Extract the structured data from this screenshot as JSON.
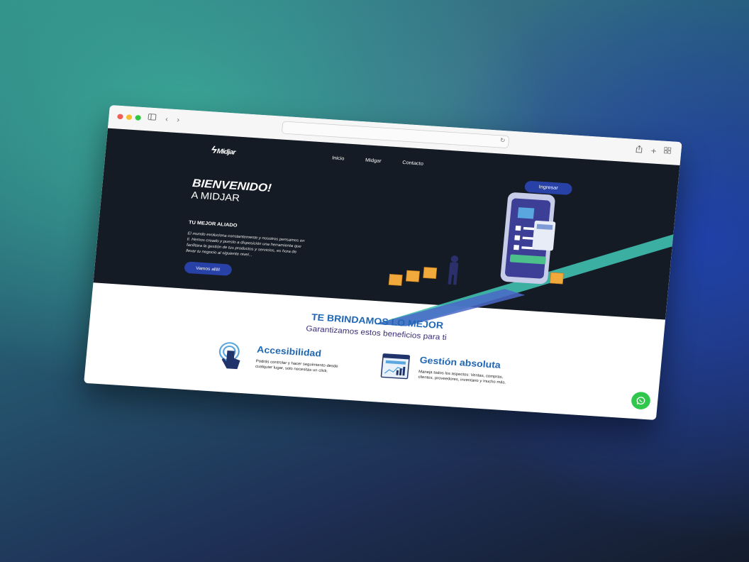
{
  "nav": {
    "logo": "Midjar",
    "items": [
      "Inicio",
      "Midgar",
      "Contacto"
    ],
    "login": "Ingresar"
  },
  "hero": {
    "title": "BIENVENIDO!",
    "subtitle": "A MIDJAR",
    "tagline": "TU MEJOR ALIADO",
    "description": "El mundo evoluciona constantemente y nosotros pensamos en ti. Hemos creado y puesto a disposición una herramienta que facilitara la gestión de tus productos y servicios, es hora de llevar tu negocio al siguiente nivel...",
    "cta": "Vamos allá!"
  },
  "benefits": {
    "title": "TE BRINDAMOS LO MEJOR",
    "subtitle": "Garantizamos estos beneficios para ti",
    "items": [
      {
        "title": "Accesibilidad",
        "description": "Podrás controlar y hacer seguimiento desde cualquier lugar, solo necesitas un click.",
        "icon": "touch-icon"
      },
      {
        "title": "Gestión absoluta",
        "description": "Maneja todos los aspectos: Ventas, compras, clientes, proveedores, inventario y mucho más.",
        "icon": "dashboard-icon"
      }
    ]
  },
  "browser": {
    "icons": [
      "sidebar-icon",
      "back-icon",
      "forward-icon",
      "reload-icon",
      "share-icon",
      "new-tab-icon",
      "tab-overview-icon"
    ]
  },
  "whatsapp": {
    "icon": "whatsapp-icon"
  },
  "colors": {
    "hero_bg": "#151b24",
    "accent_blue": "#2741a6",
    "heading_blue": "#1f67b5",
    "subheading_purple": "#3b2d7a",
    "teal": "#3fc0b0",
    "whatsapp_green": "#2fc84d"
  }
}
